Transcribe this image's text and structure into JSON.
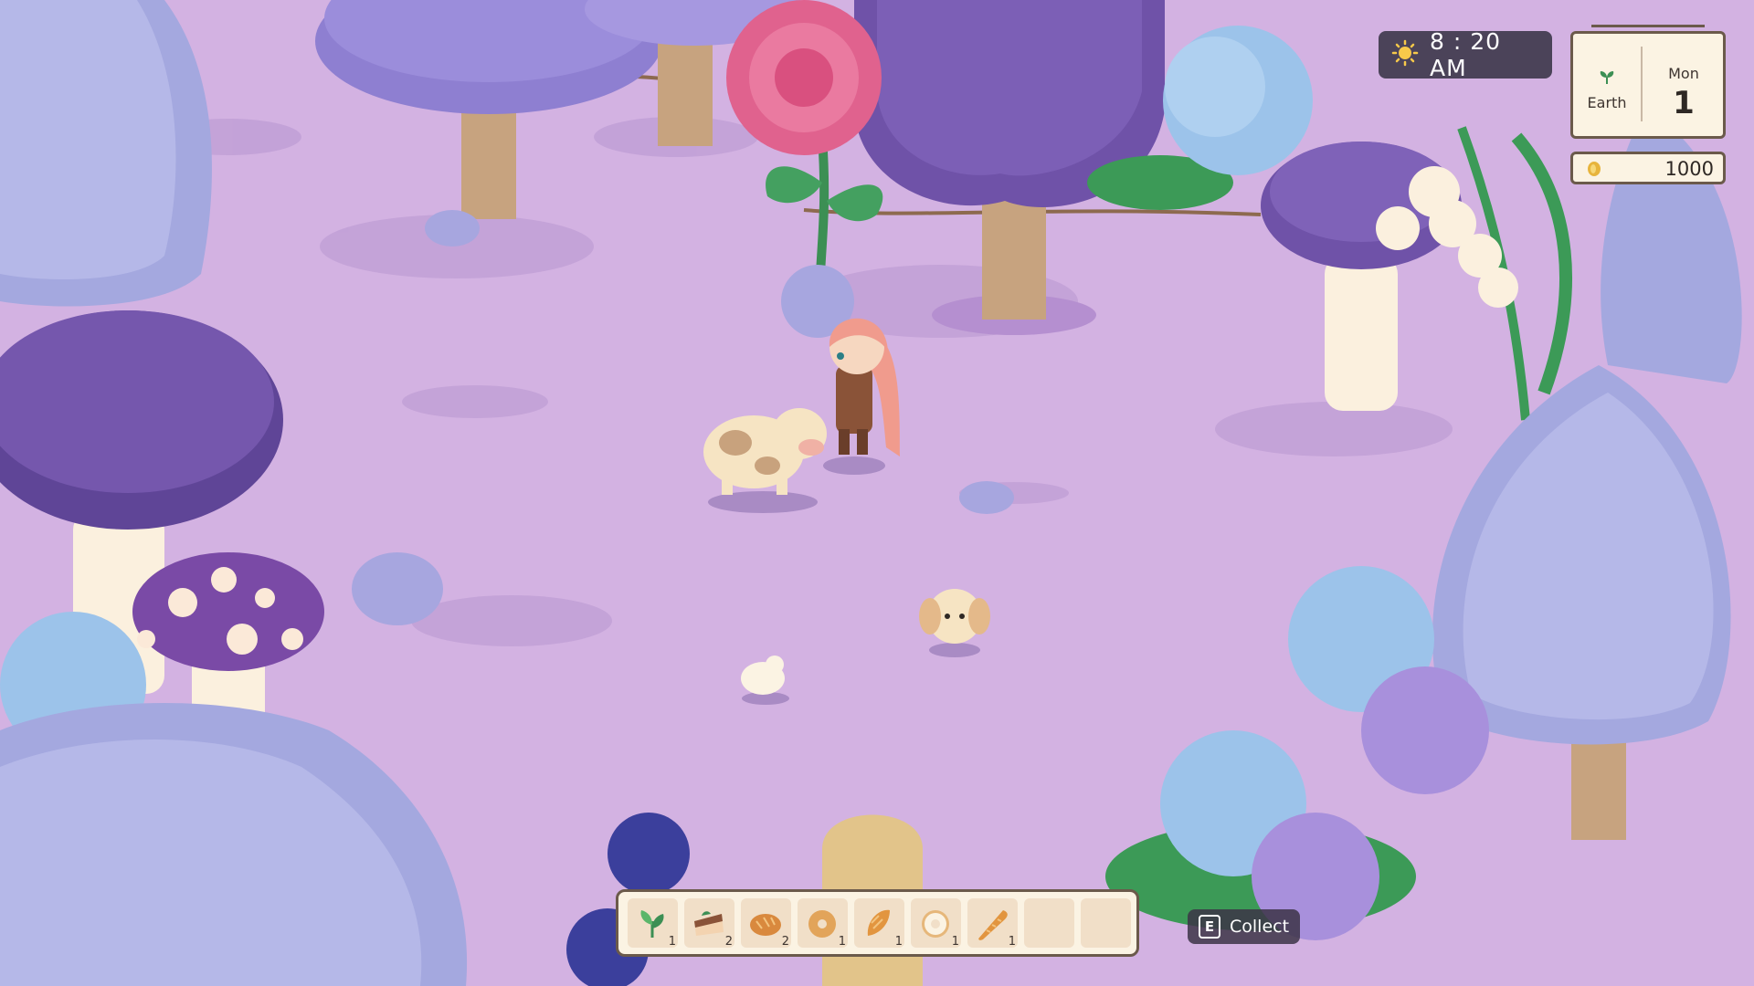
{
  "clock": {
    "time": "8 : 20 AM",
    "icon": "sun-icon"
  },
  "calendar": {
    "season": "Earth",
    "weekday": "Mon",
    "day": "1",
    "icon": "sprout-icon"
  },
  "money": {
    "amount": "1000",
    "icon": "coin-icon"
  },
  "hotbar": {
    "slots": [
      {
        "item": "herb",
        "icon": "herb-icon",
        "count": "1"
      },
      {
        "item": "cake",
        "icon": "cake-icon",
        "count": "2"
      },
      {
        "item": "bread-roll",
        "icon": "bread-roll-icon",
        "count": "2"
      },
      {
        "item": "bagel",
        "icon": "bagel-icon",
        "count": "1"
      },
      {
        "item": "croissant",
        "icon": "croissant-icon",
        "count": "1"
      },
      {
        "item": "donut",
        "icon": "donut-icon",
        "count": "1"
      },
      {
        "item": "baguette",
        "icon": "baguette-icon",
        "count": "1"
      },
      {
        "item": "",
        "icon": "",
        "count": ""
      },
      {
        "item": "",
        "icon": "",
        "count": ""
      }
    ]
  },
  "prompt": {
    "key": "E",
    "label": "Collect"
  },
  "colors": {
    "ground": "#d3b2e2",
    "hud_dark": "#4b4359",
    "panel": "#fbf3e3",
    "panel_border": "#6b5a4b",
    "sun": "#f7c94a",
    "coin": "#e7b43c"
  }
}
